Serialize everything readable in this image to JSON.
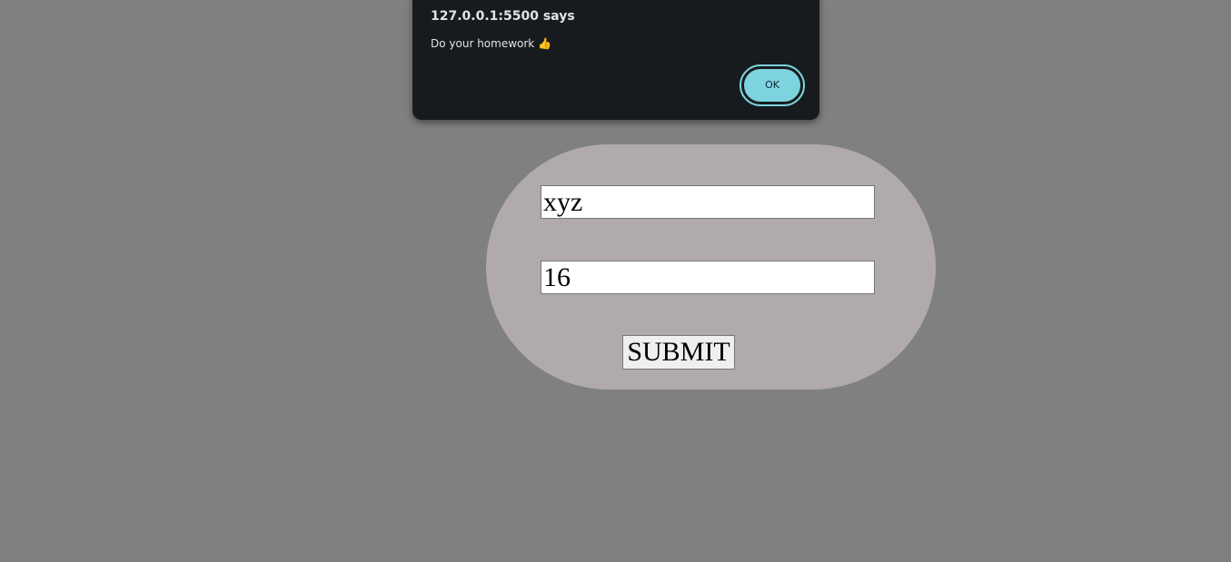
{
  "dialog": {
    "title": "127.0.0.1:5500 says",
    "message": "Do your homework 👍",
    "ok_label": "OK"
  },
  "form": {
    "name_value": "xyz",
    "age_value": "16",
    "submit_label": "SUBMIT"
  },
  "colors": {
    "page_background": "#808080",
    "card_background": "#b0aaaa",
    "dialog_background": "#171b1e",
    "ok_accent": "#7dd3de"
  }
}
